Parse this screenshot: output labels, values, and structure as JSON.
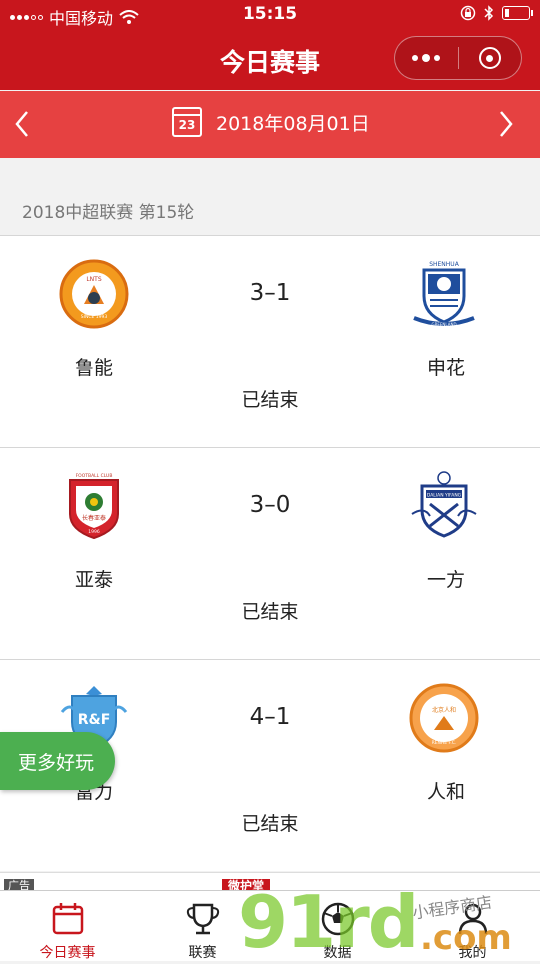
{
  "status_bar": {
    "carrier": "中国移动",
    "time": "15:15"
  },
  "nav": {
    "title": "今日赛事"
  },
  "date_bar": {
    "calendar_day": "23",
    "date": "2018年08月01日",
    "prev_arrow": "‹",
    "next_arrow": "›"
  },
  "league": {
    "title": "2018中超联赛 第15轮"
  },
  "matches": [
    {
      "home": "鲁能",
      "away": "申花",
      "score": "3–1",
      "status": "已结束",
      "home_logo_text": "LNTS",
      "home_logo_sub": "SINCE 1993",
      "home_logo_ring": "SHANDONG TAISHAN F.C.",
      "away_logo_text": "SHENHUA",
      "away_logo_sub": "GREENLAND"
    },
    {
      "home": "亚泰",
      "away": "一方",
      "score": "3–0",
      "status": "已结束",
      "home_logo_text": "长春亚泰",
      "home_logo_sub": "1996",
      "home_logo_ring": "FOOTBALL CLUB",
      "away_logo_text": "DALIAN YIFANG"
    },
    {
      "home": "富力",
      "away": "人和",
      "score": "4–1",
      "status": "已结束",
      "home_logo_text": "R&F",
      "away_logo_text": "北京人和",
      "away_logo_ring": "RENHE F.C."
    }
  ],
  "fun_button": {
    "label": "更多好玩"
  },
  "ad": {
    "label": "广告",
    "brand": "微护堂"
  },
  "tabs": [
    {
      "label": "今日赛事",
      "icon": "calendar-icon",
      "active": true
    },
    {
      "label": "联赛",
      "icon": "trophy-icon",
      "active": false
    },
    {
      "label": "数据",
      "icon": "football-icon",
      "active": false
    },
    {
      "label": "我的",
      "icon": "user-icon",
      "active": false
    }
  ],
  "watermark": {
    "main": "91rd",
    "suffix": ".com",
    "store": "小程序商店"
  },
  "colors": {
    "brand_red": "#c8161d",
    "date_bar_red": "#e64141",
    "fun_green": "#4caf50"
  }
}
